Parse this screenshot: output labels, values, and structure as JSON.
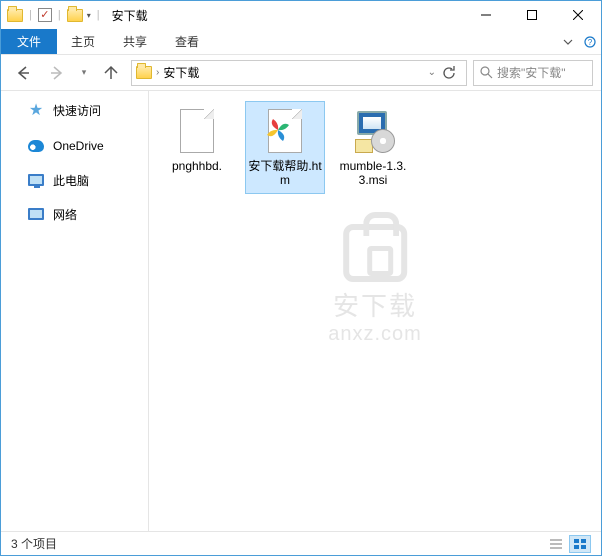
{
  "titlebar": {
    "title": "安下载"
  },
  "ribbon": {
    "file": "文件",
    "home": "主页",
    "share": "共享",
    "view": "查看"
  },
  "addressbar": {
    "location": "安下载"
  },
  "search": {
    "placeholder": "搜索\"安下载\""
  },
  "sidebar": {
    "items": [
      {
        "label": "快速访问"
      },
      {
        "label": "OneDrive"
      },
      {
        "label": "此电脑"
      },
      {
        "label": "网络"
      }
    ]
  },
  "files": [
    {
      "label": "pnghhbd."
    },
    {
      "label": "安下载帮助.htm"
    },
    {
      "label": "mumble-1.3.3.msi"
    }
  ],
  "watermark": {
    "line1": "安下载",
    "line2": "anxz.com"
  },
  "status": {
    "text": "3 个项目"
  }
}
